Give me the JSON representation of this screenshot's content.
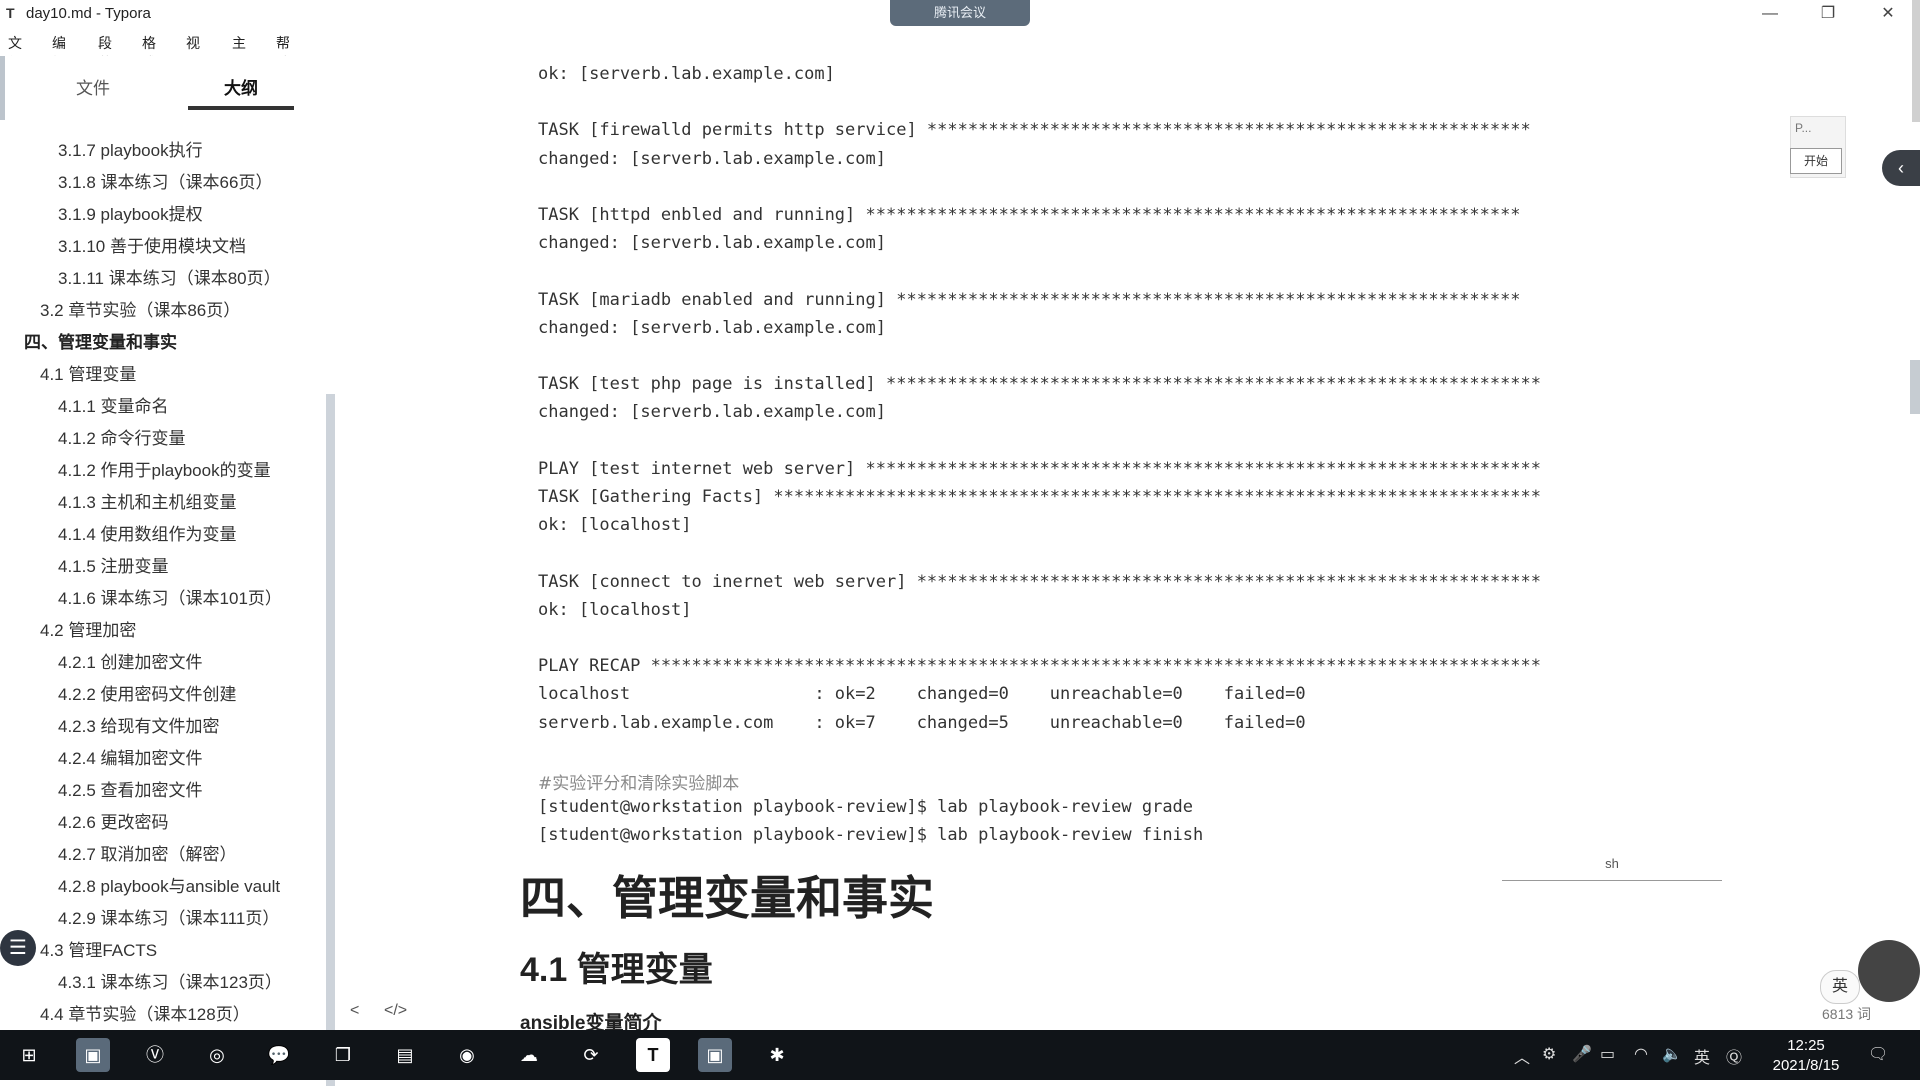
{
  "window": {
    "app_icon": "T",
    "title": "day10.md - Typora",
    "meeting_label": "腾讯会议"
  },
  "menu": [
    "文件",
    "编辑",
    "段落",
    "格式",
    "视图",
    "主题",
    "帮助"
  ],
  "sidebar": {
    "tabs": [
      "文件",
      "大纲"
    ],
    "outline": [
      "3.1.7 playbook执行",
      "3.1.8 课本练习（课本66页）",
      "3.1.9 playbook提权",
      "3.1.10 善于使用模块文档",
      "3.1.11 课本练习（课本80页）",
      "3.2 章节实验（课本86页）",
      "四、管理变量和事实",
      "4.1 管理变量",
      "4.1.1 变量命名",
      "4.1.2 命令行变量",
      "4.1.2 作用于playbook的变量",
      "4.1.3 主机和主机组变量",
      "4.1.4 使用数组作为变量",
      "4.1.5 注册变量",
      "4.1.6 课本练习（课本101页）",
      "4.2 管理加密",
      "4.2.1 创建加密文件",
      "4.2.2 使用密码文件创建",
      "4.2.3 给现有文件加密",
      "4.2.4 编辑加密文件",
      "4.2.5 查看加密文件",
      "4.2.6 更改密码",
      "4.2.7 取消加密（解密）",
      "4.2.8 playbook与ansible vault",
      "4.2.9 课本练习（课本111页）",
      "4.3 管理FACTS",
      "4.3.1 课本练习（课本123页）",
      "4.4 章节实验（课本128页）"
    ],
    "outline_levels": [
      3,
      3,
      3,
      3,
      3,
      2,
      1,
      2,
      3,
      3,
      3,
      3,
      3,
      3,
      3,
      2,
      3,
      3,
      3,
      3,
      3,
      3,
      3,
      3,
      3,
      2,
      3,
      2
    ],
    "bottom_icons": [
      "<",
      "</>"
    ]
  },
  "code": [
    "ok: [serverb.lab.example.com]",
    "",
    "TASK [firewalld permits http service] ***********************************************************",
    "changed: [serverb.lab.example.com]",
    "",
    "TASK [httpd enbled and running] ****************************************************************",
    "changed: [serverb.lab.example.com]",
    "",
    "TASK [mariadb enabled and running] *************************************************************",
    "changed: [serverb.lab.example.com]",
    "",
    "TASK [test php page is installed] ****************************************************************",
    "changed: [serverb.lab.example.com]",
    "",
    "PLAY [test internet web server] ******************************************************************",
    "TASK [Gathering Facts] ***************************************************************************",
    "ok: [localhost]",
    "",
    "TASK [connect to inernet web server] *************************************************************",
    "ok: [localhost]",
    "",
    "PLAY RECAP ***************************************************************************************",
    "localhost                  : ok=2    changed=0    unreachable=0    failed=0",
    "serverb.lab.example.com    : ok=7    changed=5    unreachable=0    failed=0",
    "",
    "#实验评分和清除实验脚本",
    "[student@workstation playbook-review]$ lab playbook-review grade",
    "[student@workstation playbook-review]$ lab playbook-review finish"
  ],
  "code_lang": "sh",
  "headings": {
    "h1": "四、管理变量和事实",
    "h2": "4.1 管理变量",
    "h3": "ansible变量简介"
  },
  "right": {
    "tool_label": "P...",
    "start_label": "开始",
    "ime": "英",
    "word_count": "6813 词"
  },
  "taskbar": {
    "tray_lang": "英",
    "time": "12:25",
    "date": "2021/8/15"
  }
}
